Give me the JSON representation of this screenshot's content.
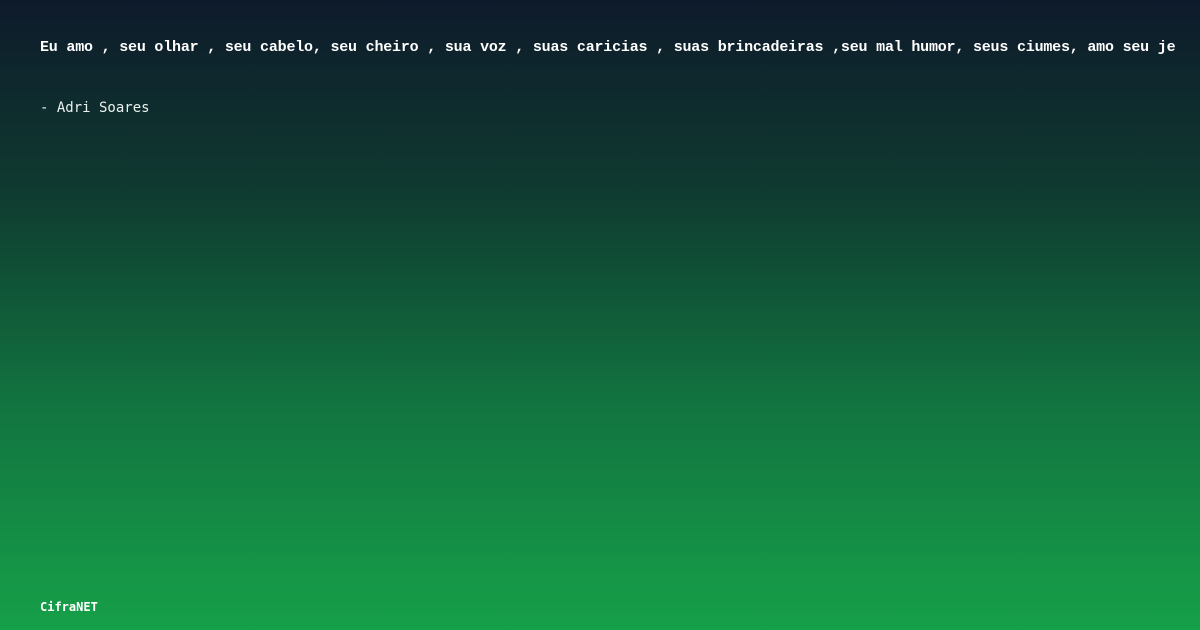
{
  "quote": {
    "text": "Eu amo , seu olhar , seu cabelo, seu cheiro , sua voz , suas caricias , suas brincadeiras ,seu mal humor, seus ciumes, amo seu je"
  },
  "author": {
    "text": "- Adri Soares"
  },
  "brand": {
    "name": "CifraNET"
  },
  "colors": {
    "background_top": "#0e1a2b",
    "background_bottom": "#16a049",
    "text": "#ffffff"
  }
}
